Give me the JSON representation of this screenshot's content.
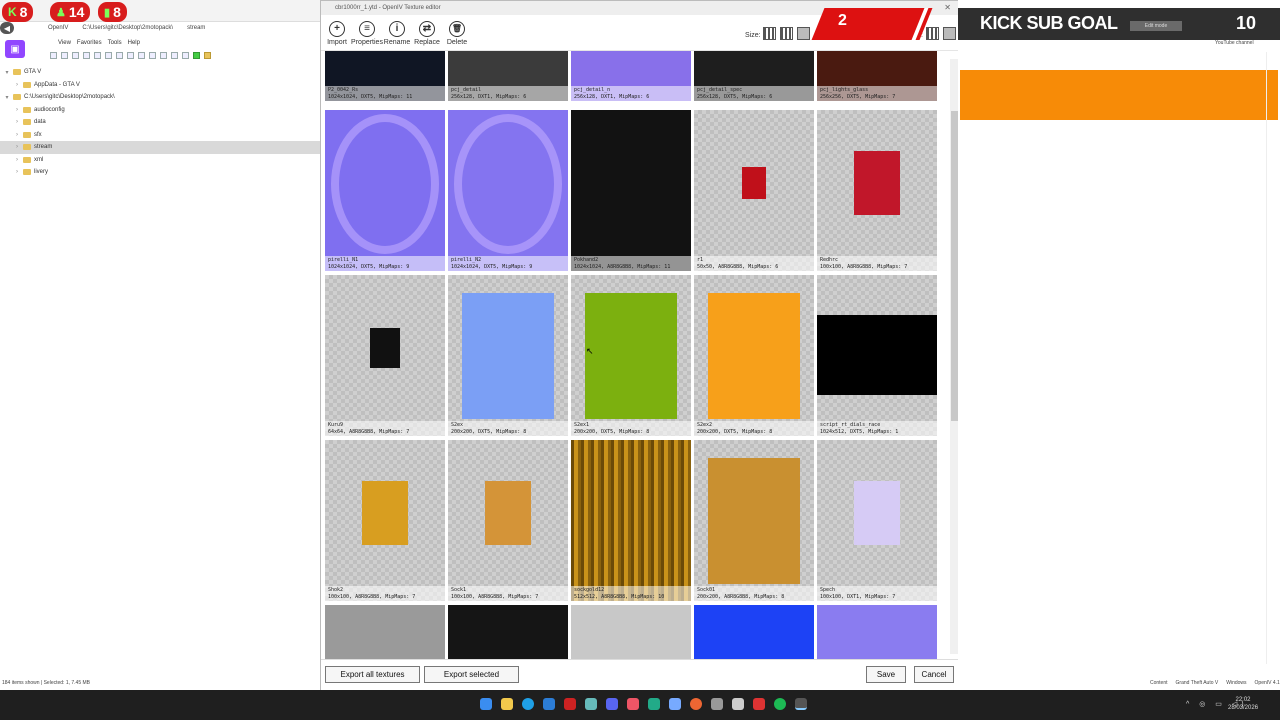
{
  "stream_overlay": {
    "kills": "8",
    "kills_icon": "k-icon",
    "followers": "14",
    "subs": "8",
    "red_banner_value": "2",
    "kick_sub_goal_label": "KICK SUB GOAL",
    "kick_sub_goal_value": "10",
    "edit_mode_label": "Edit mode",
    "youtube_channel_label": "YouTube channel"
  },
  "explorer": {
    "app_name": "OpenIV",
    "address_path": "C:\\Users\\gitc\\Desktop\\2motopack\\",
    "address_tail": "stream",
    "menu": [
      "File",
      "Edit",
      "View",
      "Favorites",
      "Tools",
      "Help"
    ],
    "tree": [
      {
        "label": "GTA V",
        "indent": 0,
        "expanded": true
      },
      {
        "label": "AppData - GTA V",
        "indent": 1,
        "expanded": false
      },
      {
        "label": "C:\\Users\\gitc\\Desktop\\2motopack\\",
        "indent": 0,
        "expanded": true
      },
      {
        "label": "audioconfig",
        "indent": 1,
        "expanded": false
      },
      {
        "label": "data",
        "indent": 1,
        "expanded": false
      },
      {
        "label": "sfx",
        "indent": 1,
        "expanded": false
      },
      {
        "label": "stream",
        "indent": 1,
        "expanded": false,
        "selected": true
      },
      {
        "label": "xml",
        "indent": 1,
        "expanded": false
      },
      {
        "label": "livery",
        "indent": 1,
        "expanded": false
      }
    ],
    "status": "184 items shown | Selected: 1, 7.45 MB"
  },
  "texture_editor": {
    "title": "cbr1000rr_1.ytd - OpenIV Texture editor",
    "tools": [
      {
        "label": "Import",
        "icon": "plus-icon"
      },
      {
        "label": "Properties",
        "icon": "properties-icon"
      },
      {
        "label": "Rename",
        "icon": "info-icon"
      },
      {
        "label": "Replace",
        "icon": "replace-icon"
      },
      {
        "label": "Delete",
        "icon": "trash-icon"
      }
    ],
    "size_label": "Size:",
    "view_label": "View:",
    "textures": [
      {
        "name": "P2_0042_Rs",
        "info": "1024x1024, DXT5, MipMaps: 11",
        "bg": "#101624",
        "swatch": null
      },
      {
        "name": "pcj_detail",
        "info": "256x128, DXT1, MipMaps: 6",
        "bg": "#3b3b3b",
        "swatch": null
      },
      {
        "name": "pcj_detail_n",
        "info": "256x128, DXT1, MipMaps: 6",
        "bg": "#8870ea",
        "swatch": null
      },
      {
        "name": "pcj_detail_spec",
        "info": "256x128, DXT5, MipMaps: 6",
        "bg": "#1e1e1e",
        "swatch": null
      },
      {
        "name": "pcj_lights_glass",
        "info": "256x256, DXT5, MipMaps: 7",
        "bg": "#4a1a10",
        "swatch": null
      },
      {
        "name": "pirelli_N1",
        "info": "1024x1024, DXT5, MipMaps: 9",
        "bg": "#7f6ff0",
        "swatch": "ring"
      },
      {
        "name": "pirelli_N2",
        "info": "1024x1024, DXT5, MipMaps: 9",
        "bg": "#8474f0",
        "swatch": "ring"
      },
      {
        "name": "Pokhand2",
        "info": "1024x1024, A8R8G8B8, MipMaps: 11",
        "bg": "#121212",
        "swatch": null
      },
      {
        "name": "r1",
        "info": "50x50, A8R8G8B8, MipMaps: 6",
        "bg": "checker",
        "swatch": {
          "color": "#c0101a",
          "w": 24,
          "h": 32
        }
      },
      {
        "name": "Redhrc",
        "info": "100x100, A8R8G8B8, MipMaps: 7",
        "bg": "checker",
        "swatch": {
          "color": "#c1172a",
          "w": 46,
          "h": 64
        }
      },
      {
        "name": "Kuru9",
        "info": "64x64, A8R8G8B8, MipMaps: 7",
        "bg": "checker",
        "swatch": {
          "color": "#111",
          "w": 30,
          "h": 40
        }
      },
      {
        "name": "S2ex",
        "info": "200x200, DXT5, MipMaps: 8",
        "bg": "checker",
        "swatch": {
          "color": "#7b9ff5",
          "w": 92,
          "h": 126
        }
      },
      {
        "name": "S2ex1",
        "info": "200x200, DXT5, MipMaps: 8",
        "bg": "checker",
        "swatch": {
          "color": "#7cb00f",
          "w": 92,
          "h": 126
        }
      },
      {
        "name": "S2ex2",
        "info": "200x200, DXT5, MipMaps: 8",
        "bg": "checker",
        "swatch": {
          "color": "#f7a01a",
          "w": 92,
          "h": 126
        }
      },
      {
        "name": "script_rt_dials_race",
        "info": "1024x512, DXT5, MipMaps: 1",
        "bg": "checker",
        "swatch": {
          "color": "#000",
          "w": 120,
          "h": 80
        }
      },
      {
        "name": "Shok2",
        "info": "100x100, A8R8G8B8, MipMaps: 7",
        "bg": "checker",
        "swatch": {
          "color": "#d89e20",
          "w": 46,
          "h": 64
        }
      },
      {
        "name": "Sock1",
        "info": "100x100, A8R8G8B8, MipMaps: 7",
        "bg": "checker",
        "swatch": {
          "color": "#d49438",
          "w": 46,
          "h": 64
        }
      },
      {
        "name": "sockgold12",
        "info": "512x512, A8R8G8B8, MipMaps: 10",
        "bg": "gold",
        "swatch": null
      },
      {
        "name": "Sock01",
        "info": "200x200, A8R8G8B8, MipMaps: 8",
        "bg": "checker",
        "swatch": {
          "color": "#c99030",
          "w": 92,
          "h": 126
        }
      },
      {
        "name": "Spech",
        "info": "100x100, DXT1, MipMaps: 7",
        "bg": "checker",
        "swatch": {
          "color": "#d6cbf5",
          "w": 46,
          "h": 64
        }
      },
      {
        "name": "",
        "info": "",
        "bg": "#9a9a9a",
        "swatch": null
      },
      {
        "name": "",
        "info": "",
        "bg": "#151515",
        "swatch": null
      },
      {
        "name": "",
        "info": "",
        "bg": "#c8c8c8",
        "swatch": null
      },
      {
        "name": "",
        "info": "",
        "bg": "#1d42f5",
        "swatch": null
      },
      {
        "name": "",
        "info": "",
        "bg": "#8a7cf0",
        "swatch": null
      }
    ],
    "buttons": {
      "export_all": "Export all textures",
      "export_selected": "Export selected",
      "save": "Save",
      "cancel": "Cancel"
    }
  },
  "right_panel": {
    "status": [
      "Content",
      "Grand Theft Auto V",
      "Windows",
      "OpenIV 4.1"
    ]
  },
  "taskbar": {
    "time": "22:02",
    "date": "28/03/2026"
  }
}
